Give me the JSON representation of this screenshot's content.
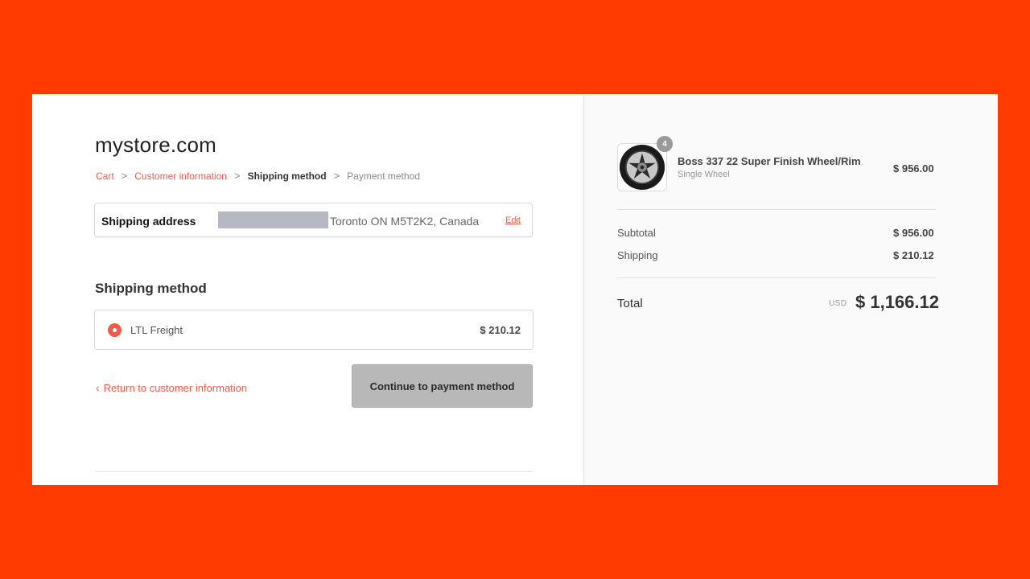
{
  "store": {
    "title": "mystore.com"
  },
  "breadcrumb": {
    "items": [
      "Cart",
      "Customer information",
      "Shipping method",
      "Payment method"
    ],
    "separator": ">"
  },
  "shipping_address": {
    "label": "Shipping address",
    "address": "Toronto ON M5T2K2, Canada",
    "edit_label": "Edit"
  },
  "shipping_method": {
    "title": "Shipping method",
    "option_label": "LTL Freight",
    "option_price": "$ 210.12",
    "selected": true
  },
  "nav": {
    "return_label": "Return to customer information",
    "continue_label": "Continue to payment method"
  },
  "summary": {
    "product": {
      "name": "Boss 337 22 Super Finish Wheel/Rim",
      "variant": "Single Wheel",
      "price": "$ 956.00",
      "quantity": "4",
      "icon": "wheel-rim-icon"
    },
    "subtotal_label": "Subtotal",
    "subtotal_value": "$ 956.00",
    "shipping_label": "Shipping",
    "shipping_value": "$ 210.12",
    "total_label": "Total",
    "currency": "USD",
    "total_value": "$ 1,166.12"
  },
  "colors": {
    "background": "#ff3c00",
    "accent": "#f25a4a",
    "button_disabled": "#b8b8b8",
    "summary_bg": "#fafafa"
  }
}
